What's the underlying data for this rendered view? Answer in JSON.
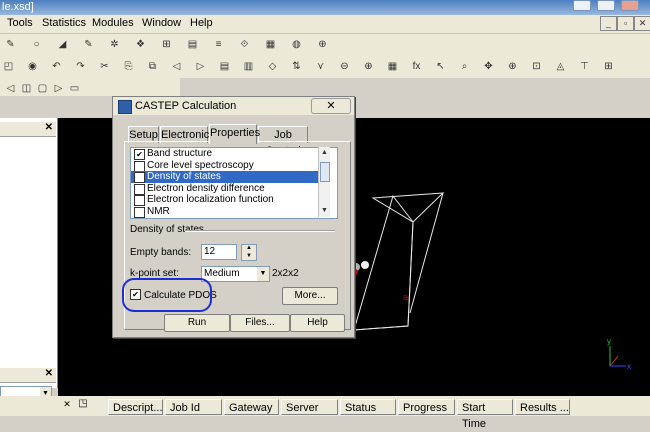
{
  "window": {
    "title_fragment": "le.xsd]"
  },
  "menu": [
    "Tools",
    "Statistics",
    "Modules",
    "Window",
    "Help"
  ],
  "toolbar": {
    "row1": [
      "✎",
      "○",
      "◢",
      "✎",
      "✲",
      "❖",
      "⊞",
      "▤",
      "≡",
      "⟐",
      "▦",
      "◍",
      "⊕"
    ],
    "row2": [
      "◰",
      "◉",
      "↶",
      "↷",
      "✂",
      "⎘",
      "⧉",
      "◁",
      "▷",
      "▤",
      "▥",
      "◇",
      "⇅",
      "⋎",
      "⊖",
      "⊕",
      "▦",
      "fx",
      "↖",
      "⌕",
      "✥",
      "⊕",
      "⊡",
      "◬",
      "⊤",
      "⊞"
    ],
    "row3": [
      "◁",
      "◫",
      "▢",
      "▷",
      "▭"
    ]
  },
  "dialog": {
    "title": "CASTEP Calculation",
    "close_label": "✕",
    "tabs": [
      "Setup",
      "Electronic",
      "Properties",
      "Job Control"
    ],
    "active_tab": "Properties",
    "properties": [
      {
        "label": "Band structure",
        "checked": "✔"
      },
      {
        "label": "Core level spectroscopy",
        "checked": ""
      },
      {
        "label": "Density of states",
        "checked": "✔"
      },
      {
        "label": "Electron density difference",
        "checked": ""
      },
      {
        "label": "Electron localization function",
        "checked": ""
      },
      {
        "label": "NMR",
        "checked": ""
      }
    ],
    "group_title": "Density of states",
    "empty_bands_label": "Empty bands:",
    "empty_bands_value": "12",
    "kpoint_label": "k-point set:",
    "kpoint_value": "Medium",
    "kpoint_grid": "2x2x2",
    "pdos_label": "Calculate PDOS",
    "pdos_checked": "✔",
    "more_button": "More...",
    "run_button": "Run",
    "files_button": "Files...",
    "help_button": "Help"
  },
  "job_columns": [
    "Descript...",
    "Job Id",
    "Gateway",
    "Server",
    "Status",
    "Progress",
    "Start Time",
    "Results ..."
  ],
  "axes": {
    "x": "x",
    "y": "y"
  }
}
